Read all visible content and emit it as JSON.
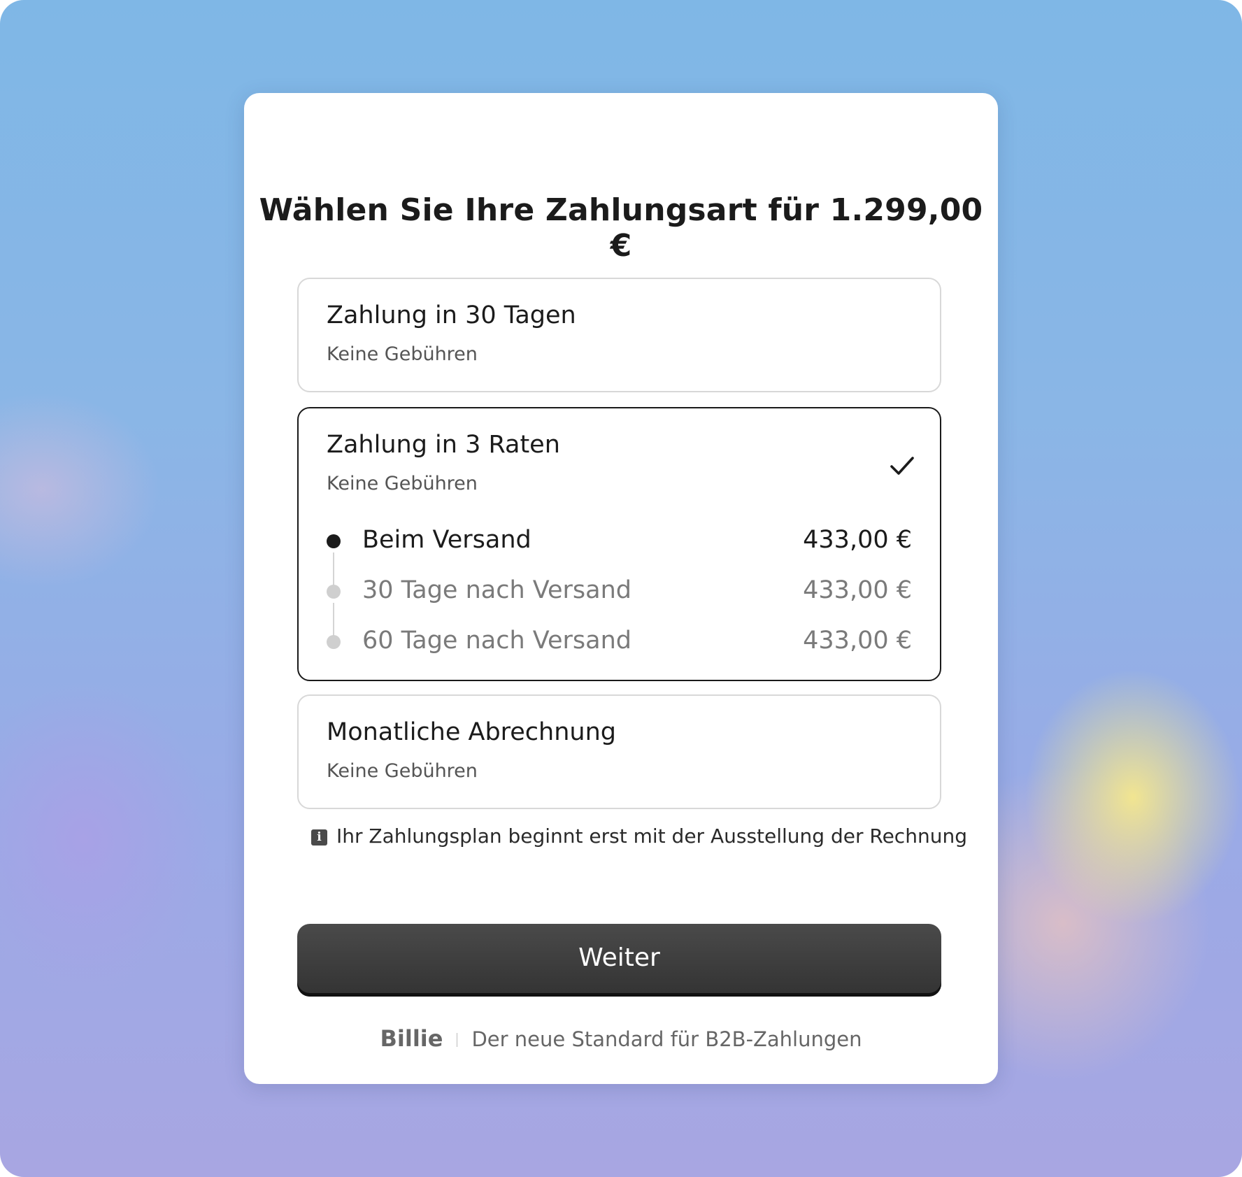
{
  "page": {
    "title": "Wählen Sie Ihre Zahlungsart für 1.299,00 €"
  },
  "options": [
    {
      "title": "Zahlung in 30 Tagen",
      "subtitle": "Keine Gebühren",
      "selected": false
    },
    {
      "title": "Zahlung in 3 Raten",
      "subtitle": "Keine Gebühren",
      "selected": true,
      "schedule": [
        {
          "label": "Beim Versand",
          "amount": "433,00 €",
          "active": true
        },
        {
          "label": "30 Tage nach Versand",
          "amount": "433,00 €",
          "active": false
        },
        {
          "label": "60 Tage nach Versand",
          "amount": "433,00 €",
          "active": false
        }
      ]
    },
    {
      "title": "Monatliche Abrechnung",
      "subtitle": "Keine Gebühren",
      "selected": false
    }
  ],
  "info": {
    "text": "Ihr Zahlungsplan beginnt erst mit der Ausstellung der Rechnung",
    "icon": "info-icon",
    "icon_glyph": "i"
  },
  "button": {
    "label": "Weiter"
  },
  "footer": {
    "brand": "Billie",
    "tagline": "Der neue Standard für B2B-Zahlungen"
  },
  "colors": {
    "selected_border": "#1a1a1a",
    "button_bg": "#3a3a3a"
  }
}
